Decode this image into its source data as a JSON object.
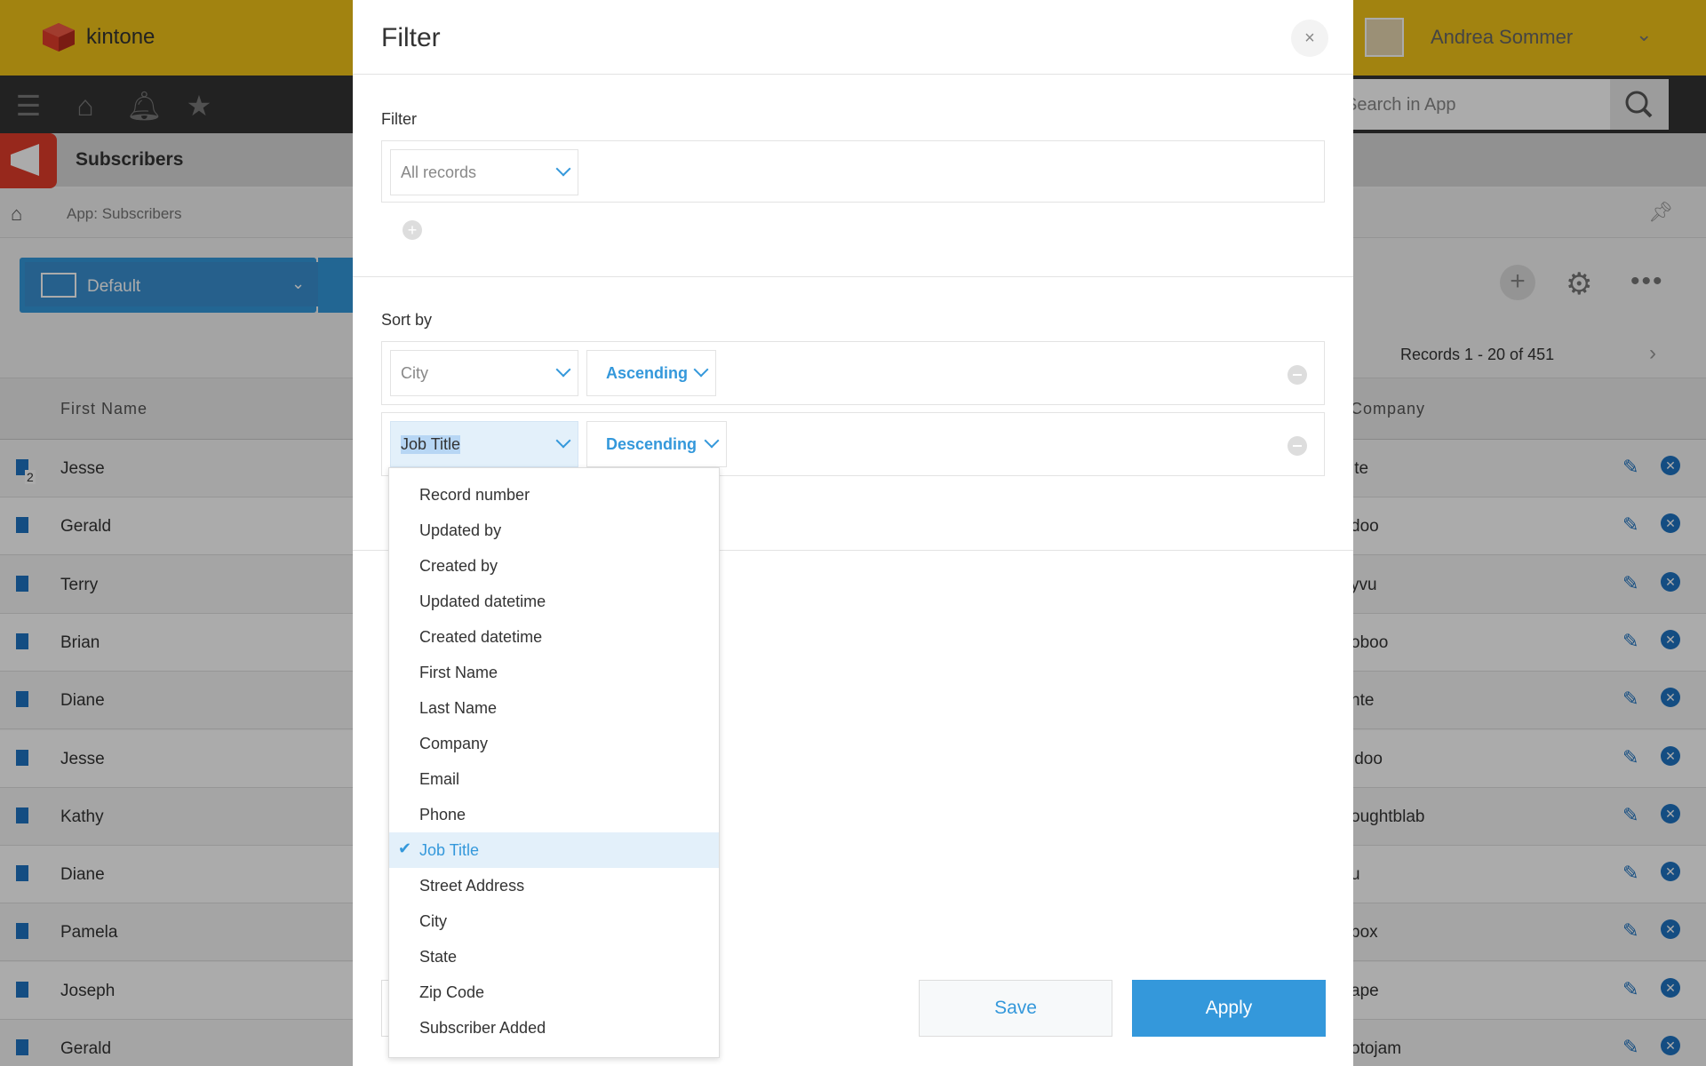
{
  "app": {
    "brand": "kintone",
    "user_name": "Andrea Sommer",
    "search_placeholder": "Search in App",
    "app_name": "Subscribers",
    "breadcrumb": "App: Subscribers",
    "view_name": "Default",
    "record_count": "Records 1 - 20 of 451",
    "columns": [
      "First Name",
      "Company"
    ],
    "rows": [
      {
        "first_name": "Jesse",
        "company": "ite",
        "badge": "2"
      },
      {
        "first_name": "Gerald",
        "company": "doo"
      },
      {
        "first_name": "Terry",
        "company": "yvu"
      },
      {
        "first_name": "Brian",
        "company": "oboo"
      },
      {
        "first_name": "Diane",
        "company": "nte"
      },
      {
        "first_name": "Jesse",
        "company": "idoo"
      },
      {
        "first_name": "Kathy",
        "company": "oughtblab"
      },
      {
        "first_name": "Diane",
        "company": "u"
      },
      {
        "first_name": "Pamela",
        "company": "box"
      },
      {
        "first_name": "Joseph",
        "company": "ape"
      },
      {
        "first_name": "Gerald",
        "company": "otojam"
      }
    ]
  },
  "modal": {
    "title": "Filter",
    "close_icon": "×",
    "filter": {
      "label": "Filter",
      "condition_value": "All records"
    },
    "sort": {
      "label": "Sort by",
      "rows": [
        {
          "field": "City",
          "order": "Ascending"
        },
        {
          "field": "Job Title",
          "order": "Descending"
        }
      ]
    },
    "dropdown": {
      "options": [
        "Record number",
        "Updated by",
        "Created by",
        "Updated datetime",
        "Created datetime",
        "First Name",
        "Last Name",
        "Company",
        "Email",
        "Phone",
        "Job Title",
        "Street Address",
        "City",
        "State",
        "Zip Code",
        "Subscriber Added"
      ],
      "selected": "Job Title"
    },
    "save_label": "Save",
    "apply_label": "Apply"
  },
  "colors": {
    "header_yellow": "#f2c418",
    "accent_blue": "#3498db",
    "app_icon_red": "#e23c2a"
  }
}
